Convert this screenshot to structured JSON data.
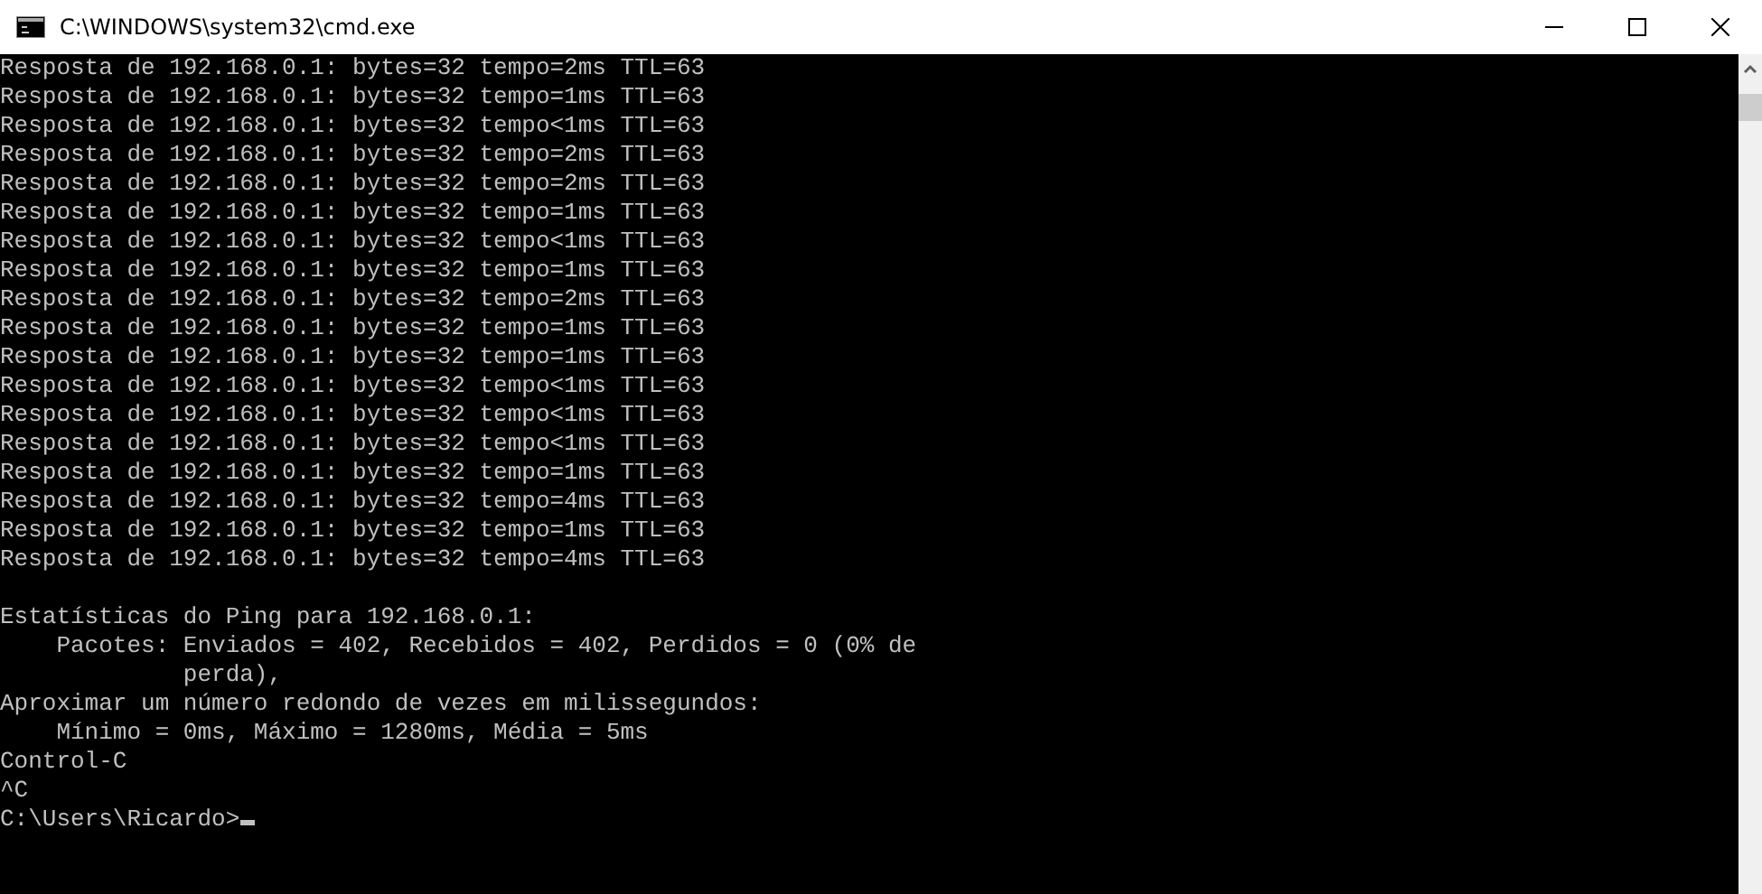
{
  "window": {
    "title": "C:\\WINDOWS\\system32\\cmd.exe"
  },
  "console": {
    "lines": [
      "Resposta de 192.168.0.1: bytes=32 tempo=2ms TTL=63",
      "Resposta de 192.168.0.1: bytes=32 tempo=1ms TTL=63",
      "Resposta de 192.168.0.1: bytes=32 tempo<1ms TTL=63",
      "Resposta de 192.168.0.1: bytes=32 tempo=2ms TTL=63",
      "Resposta de 192.168.0.1: bytes=32 tempo=2ms TTL=63",
      "Resposta de 192.168.0.1: bytes=32 tempo=1ms TTL=63",
      "Resposta de 192.168.0.1: bytes=32 tempo<1ms TTL=63",
      "Resposta de 192.168.0.1: bytes=32 tempo=1ms TTL=63",
      "Resposta de 192.168.0.1: bytes=32 tempo=2ms TTL=63",
      "Resposta de 192.168.0.1: bytes=32 tempo=1ms TTL=63",
      "Resposta de 192.168.0.1: bytes=32 tempo=1ms TTL=63",
      "Resposta de 192.168.0.1: bytes=32 tempo<1ms TTL=63",
      "Resposta de 192.168.0.1: bytes=32 tempo<1ms TTL=63",
      "Resposta de 192.168.0.1: bytes=32 tempo<1ms TTL=63",
      "Resposta de 192.168.0.1: bytes=32 tempo=1ms TTL=63",
      "Resposta de 192.168.0.1: bytes=32 tempo=4ms TTL=63",
      "Resposta de 192.168.0.1: bytes=32 tempo=1ms TTL=63",
      "Resposta de 192.168.0.1: bytes=32 tempo=4ms TTL=63"
    ],
    "summary": [
      "Estatísticas do Ping para 192.168.0.1:",
      "    Pacotes: Enviados = 402, Recebidos = 402, Perdidos = 0 (0% de",
      "             perda),",
      "Aproximar um número redondo de vezes em milissegundos:",
      "    Mínimo = 0ms, Máximo = 1280ms, Média = 5ms",
      "Control-C",
      "^C"
    ],
    "prompt": "C:\\Users\\Ricardo>"
  }
}
